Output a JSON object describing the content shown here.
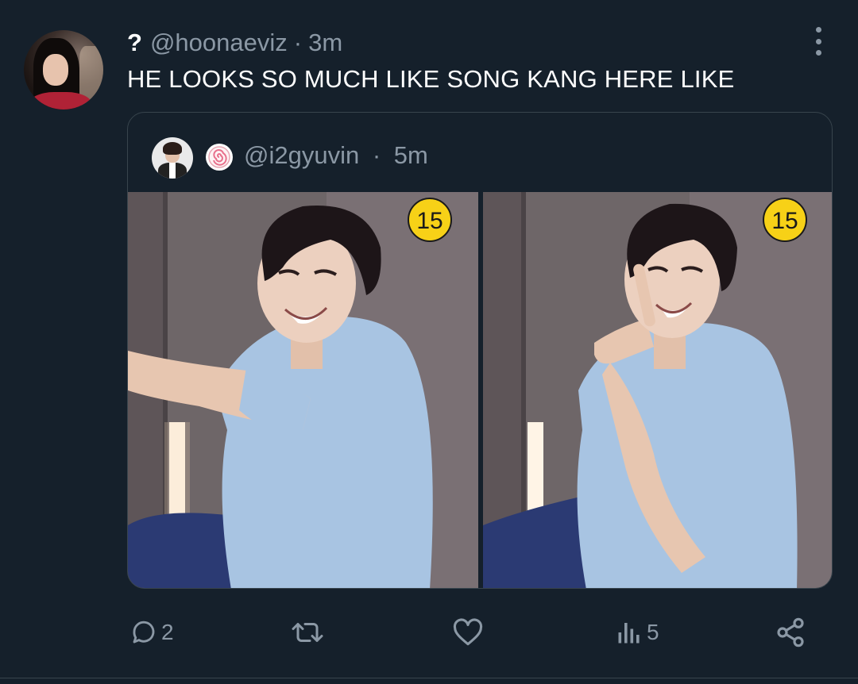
{
  "tweet": {
    "display_name": "?",
    "handle": "@hoonaeviz",
    "separator": "·",
    "time": "3m",
    "text": "HE LOOKS SO MUCH LIKE SONG KANG HERE LIKE"
  },
  "quoted": {
    "handle": "@i2gyuvin",
    "separator": "·",
    "time": "5m",
    "images": [
      {
        "badge": "15"
      },
      {
        "badge": "15"
      }
    ]
  },
  "actions": {
    "replies": "2",
    "retweets": "",
    "likes": "",
    "views": "5"
  },
  "colors": {
    "background": "#15202b",
    "secondary_text": "#8b98a5",
    "border": "#38444d",
    "badge": "#f7d117"
  }
}
